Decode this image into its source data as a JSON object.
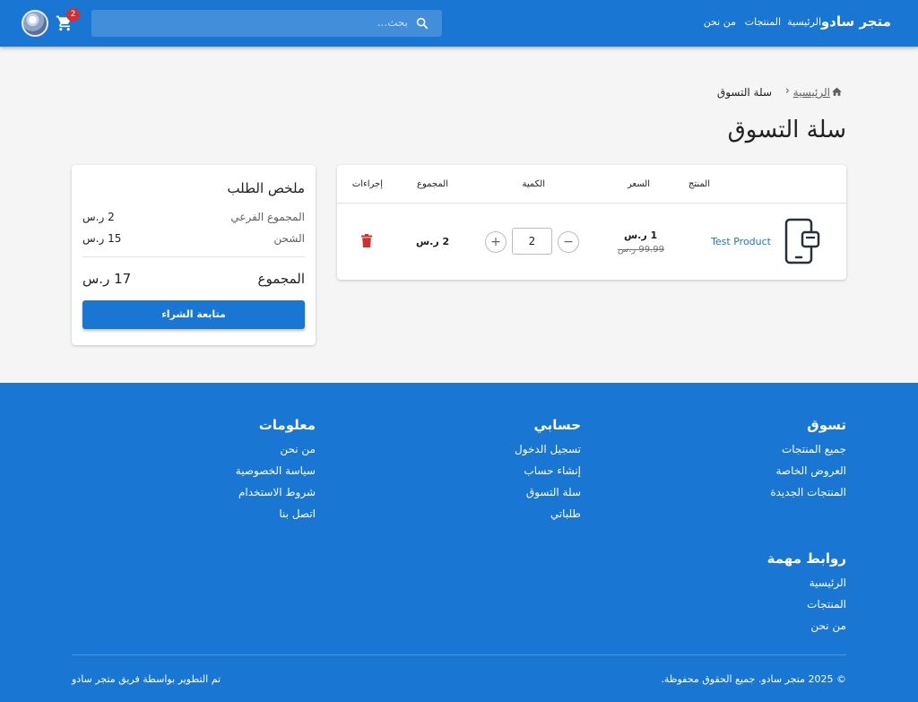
{
  "header": {
    "brand": "متجر سادو",
    "nav": [
      "الرئيسية",
      "المنتجات",
      "من نحن"
    ],
    "search_placeholder": "بحث...",
    "cart_count": "2"
  },
  "breadcrumb": {
    "home": "الرئيسية",
    "separator": "‹",
    "current": "سلة التسوق"
  },
  "page_title": "سلة التسوق",
  "cart_table": {
    "headers": {
      "product": "المنتج",
      "price": "السعر",
      "quantity": "الكمية",
      "total": "المجموع",
      "actions": "إجراءات"
    },
    "rows": [
      {
        "name": "Test Product",
        "price": "1 ر.س",
        "old_price": "99.99 ر.س",
        "quantity": "2",
        "total": "2 ر.س",
        "minus": "−",
        "plus": "+"
      }
    ]
  },
  "summary": {
    "title": "ملخص الطلب",
    "subtotal_label": "المجموع الفرعي",
    "subtotal_value": "2 ر.س",
    "shipping_label": "الشحن",
    "shipping_value": "15 ر.س",
    "total_label": "المجموع",
    "total_value": "17 ر.س",
    "checkout_label": "متابعة الشراء"
  },
  "footer": {
    "shop": {
      "heading": "تسوق",
      "links": [
        "جميع المنتجات",
        "العروض الخاصة",
        "المنتجات الجديدة"
      ]
    },
    "account": {
      "heading": "حسابي",
      "links": [
        "تسجيل الدخول",
        "إنشاء حساب",
        "سلة التسوق",
        "طلباتي"
      ]
    },
    "info": {
      "heading": "معلومات",
      "links": [
        "من نحن",
        "سياسة الخصوصية",
        "شروط الاستخدام",
        "اتصل بنا"
      ]
    },
    "important": {
      "heading": "روابط مهمة",
      "links": [
        "الرئيسية",
        "المنتجات",
        "من نحن"
      ]
    },
    "copyright": "© 2025 متجر سادو. جميع الحقوق محفوظة.",
    "credit": "تم التطوير بواسطة فريق متجر سادو"
  },
  "colors": {
    "primary": "#1976d2",
    "danger": "#d32f2f",
    "background": "#f5f5f5"
  },
  "icons": [
    "search-icon",
    "cart-icon",
    "home-icon",
    "phone-product-icon",
    "trash-icon"
  ]
}
